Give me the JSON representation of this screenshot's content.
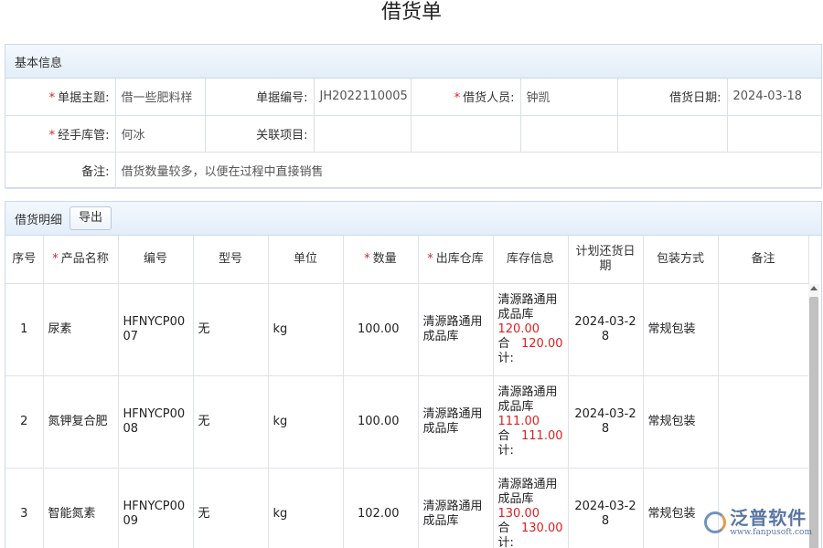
{
  "page": {
    "title": "借货单"
  },
  "basic_info": {
    "section_title": "基本信息",
    "fields": {
      "subject_label": "单据主题:",
      "subject_value": "借一些肥料样",
      "doc_no_label": "单据编号:",
      "doc_no_value": "JH2022110005",
      "borrower_label": "借货人员:",
      "borrower_value": "钟凯",
      "borrow_date_label": "借货日期:",
      "borrow_date_value": "2024-03-18",
      "keeper_label": "经手库管:",
      "keeper_value": "何冰",
      "project_label": "关联项目:",
      "project_value": "",
      "remark_label": "备注:",
      "remark_value": "借货数量较多，以便在过程中直接销售"
    },
    "required_mark": "*"
  },
  "details": {
    "section_title": "借货明细",
    "export_label": "导出",
    "columns": {
      "index": "序号",
      "product_name": "产品名称",
      "code": "编号",
      "model": "型号",
      "unit": "单位",
      "quantity": "数量",
      "warehouse": "出库仓库",
      "stock": "库存信息",
      "return_date": "计划还货日期",
      "packaging": "包装方式",
      "remark": "备注"
    },
    "rows": [
      {
        "index": "1",
        "product_name": "尿素",
        "code": "HFNYCP0007",
        "model": "无",
        "unit": "kg",
        "quantity": "100.00",
        "warehouse": "清源路通用成品库",
        "stock_wh": "清源路通用成品库",
        "stock_wh_qty": "120.00",
        "stock_total_label": "合计:",
        "stock_total_qty": "120.00",
        "return_date": "2024-03-28",
        "packaging": "常规包装",
        "remark": ""
      },
      {
        "index": "2",
        "product_name": "氮钾复合肥",
        "code": "HFNYCP0008",
        "model": "无",
        "unit": "kg",
        "quantity": "100.00",
        "warehouse": "清源路通用成品库",
        "stock_wh": "清源路通用成品库",
        "stock_wh_qty": "111.00",
        "stock_total_label": "合计:",
        "stock_total_qty": "111.00",
        "return_date": "2024-03-28",
        "packaging": "常规包装",
        "remark": ""
      },
      {
        "index": "3",
        "product_name": "智能氮素",
        "code": "HFNYCP0009",
        "model": "无",
        "unit": "kg",
        "quantity": "102.00",
        "warehouse": "清源路通用成品库",
        "stock_wh": "清源路通用成品库",
        "stock_wh_qty": "130.00",
        "stock_total_label": "合计:",
        "stock_total_qty": "130.00",
        "return_date": "2024-03-28",
        "packaging": "常规包装",
        "remark": ""
      }
    ]
  },
  "watermark": {
    "brand": "泛普软件",
    "url": "www.fanpusoft.com"
  },
  "colors": {
    "required": "#e02020",
    "stock_qty": "#e02020",
    "panel_border": "#c9d9ec",
    "brand": "#3d5f93"
  }
}
